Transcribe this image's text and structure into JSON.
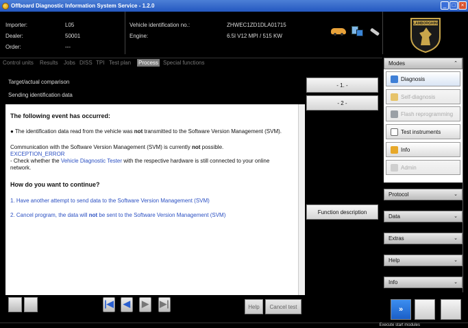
{
  "window": {
    "title": "Offboard Diagnostic Information System Service - 1.2.0"
  },
  "header": {
    "importer_label": "Importer:",
    "importer_value": "L05",
    "dealer_label": "Dealer:",
    "dealer_value": "50001",
    "order_label": "Order:",
    "order_value": "---",
    "vin_label": "Vehicle identification no.:",
    "vin_value": "ZHWEC1ZD1DLA01715",
    "engine_label": "Engine:",
    "engine_value": "6.5l V12 MPI / 515 KW",
    "logo_text": "LAMBORGHINI"
  },
  "tabs": [
    "Control units",
    "Results",
    "Jobs",
    "DISS",
    "TPI",
    "Test plan",
    "Process",
    "Special functions"
  ],
  "active_tab": "Process",
  "process": {
    "row1": "Target/actual comparison",
    "row2": "Sending identification data",
    "step1": "- 1. -",
    "step2": "- 2 -",
    "function_description": "Function description"
  },
  "content": {
    "heading": "The following event has occurred:",
    "bullet_pre": "The identification data read from the vehicle was ",
    "bullet_bold": "not",
    "bullet_post": " transmitted to the Software Version Management (SVM).",
    "comm_pre": "Communication with the Software Version Management (SVM) is currently ",
    "comm_bold": "not",
    "comm_post": " possible.",
    "error_code": "EXCEPTION_ERROR",
    "check_pre": "- Check whether the ",
    "check_link": "Vehicle Diagnostic Tester",
    "check_post": " with the respective hardware is still connected to your online",
    "check_line2": "network.",
    "question": "How do you want to continue?",
    "option1": "1. Have another attempt to send data to the Software Version Management (SVM)",
    "option2_pre": "2. Cancel program, the data will ",
    "option2_bold": "not",
    "option2_post": " be sent to the Software Version Management (SVM)"
  },
  "bottom": {
    "help_label": "Help",
    "cancel_label": "Cancel test"
  },
  "sidebar": {
    "modes_label": "Modes",
    "items": [
      {
        "label": "Diagnosis",
        "state": "active"
      },
      {
        "label": "Self-diagnosis",
        "state": "disabled"
      },
      {
        "label": "Flash reprogramming",
        "state": "disabled"
      },
      {
        "label": "Test instruments",
        "state": "normal"
      },
      {
        "label": "Info",
        "state": "normal"
      },
      {
        "label": "Admin",
        "state": "disabled"
      }
    ],
    "sections": [
      "Protocol",
      "Data",
      "Extras",
      "Help",
      "Info"
    ]
  },
  "status": {
    "text": "Execute start modules"
  },
  "colors": {
    "accent_blue": "#2a4fc2",
    "titlebar_blue": "#2458c0"
  }
}
